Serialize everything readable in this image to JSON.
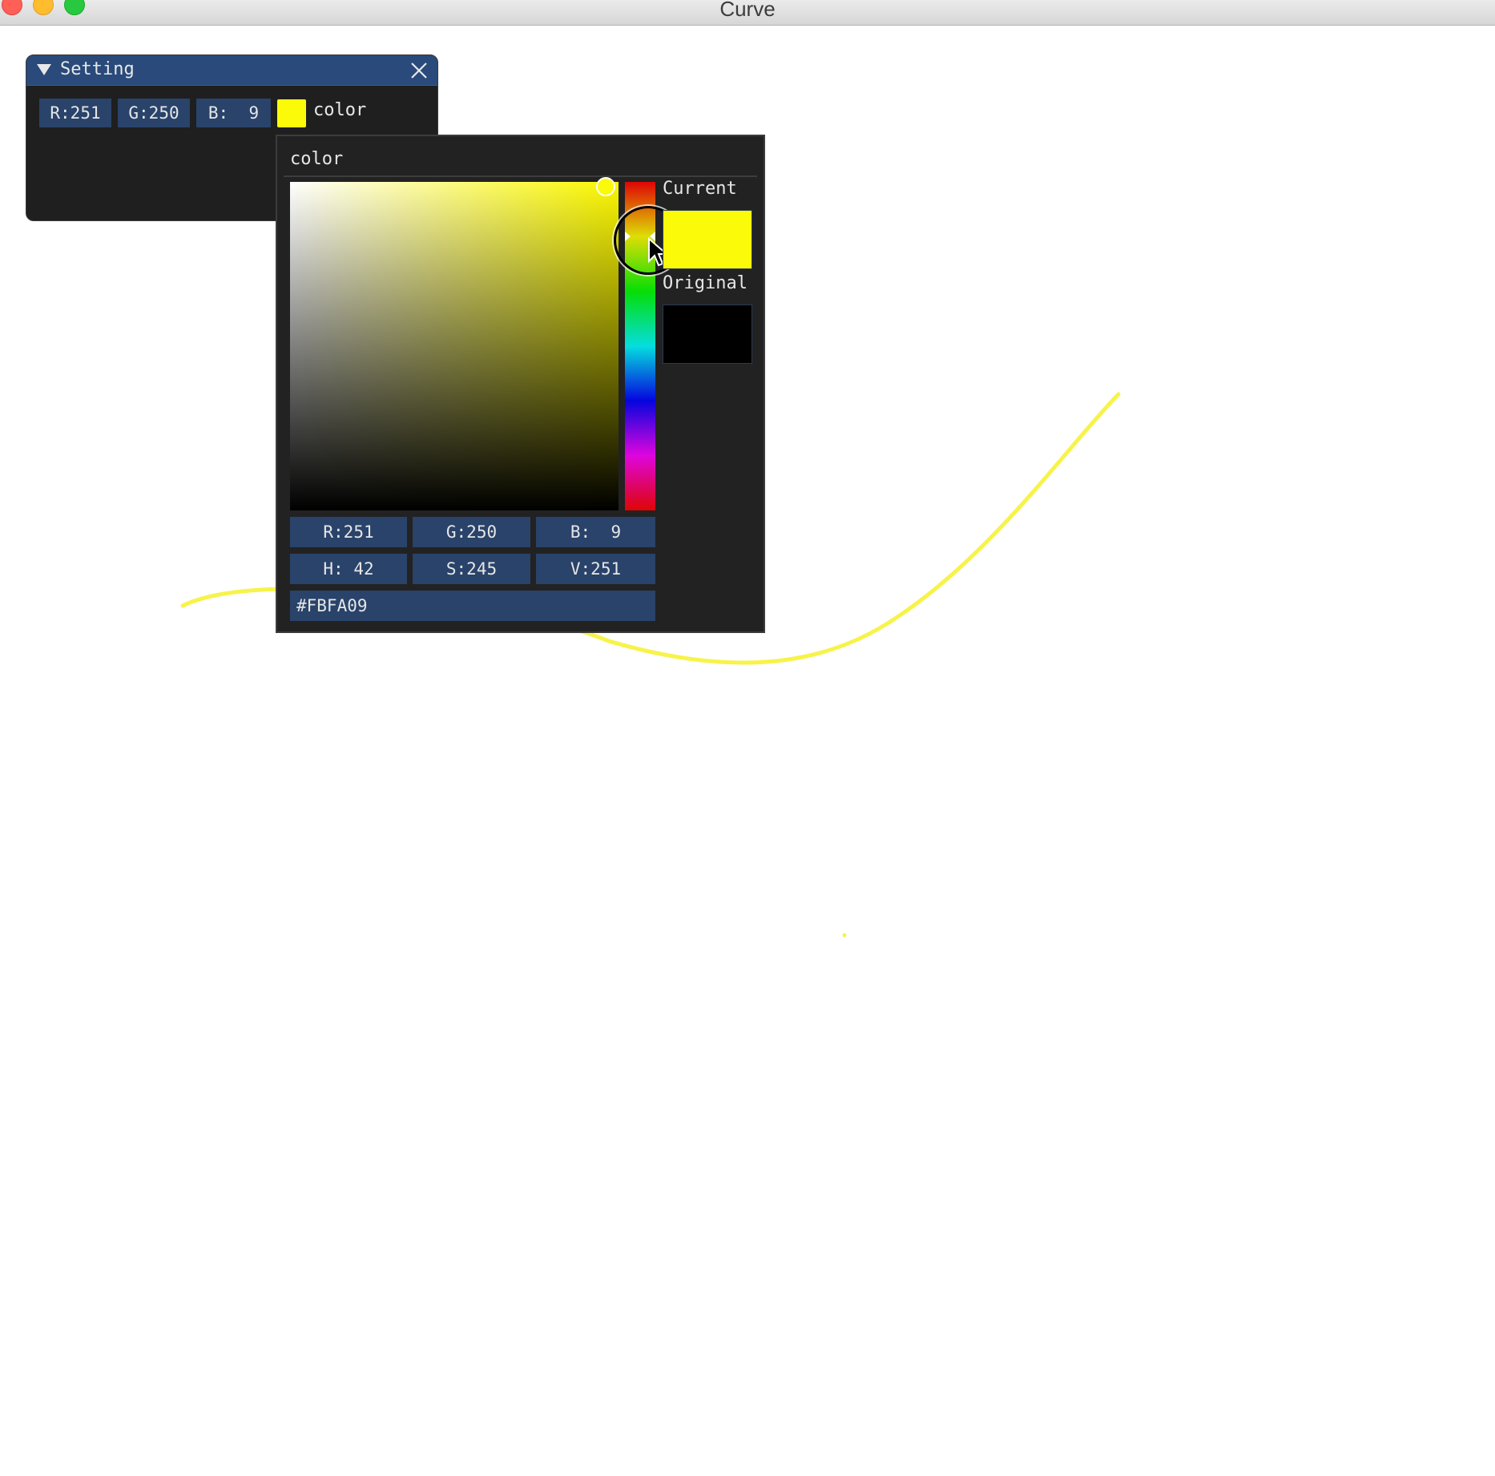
{
  "window": {
    "title": "Curve"
  },
  "setting": {
    "title": "Setting",
    "r": "R:251",
    "g": "G:250",
    "b": "B:  9",
    "color_label": "color"
  },
  "picker": {
    "title": "color",
    "current_label": "Current",
    "original_label": "Original",
    "r": "R:251",
    "g": "G:250",
    "b": "B:  9",
    "h": "H: 42",
    "s": "S:245",
    "v": "V:251",
    "hex": "#FBFA09",
    "current_color": "#FBFA09",
    "original_color": "#000000",
    "hue": 42,
    "saturation": 245,
    "value": 251
  },
  "colors": {
    "curve": "#F7F34A",
    "accent": "#294A7A",
    "field": "#29436A",
    "panel": "#1F1F1F"
  },
  "icons": [
    "collapse-triangle-icon",
    "close-icon",
    "mouse-pointer-icon"
  ]
}
